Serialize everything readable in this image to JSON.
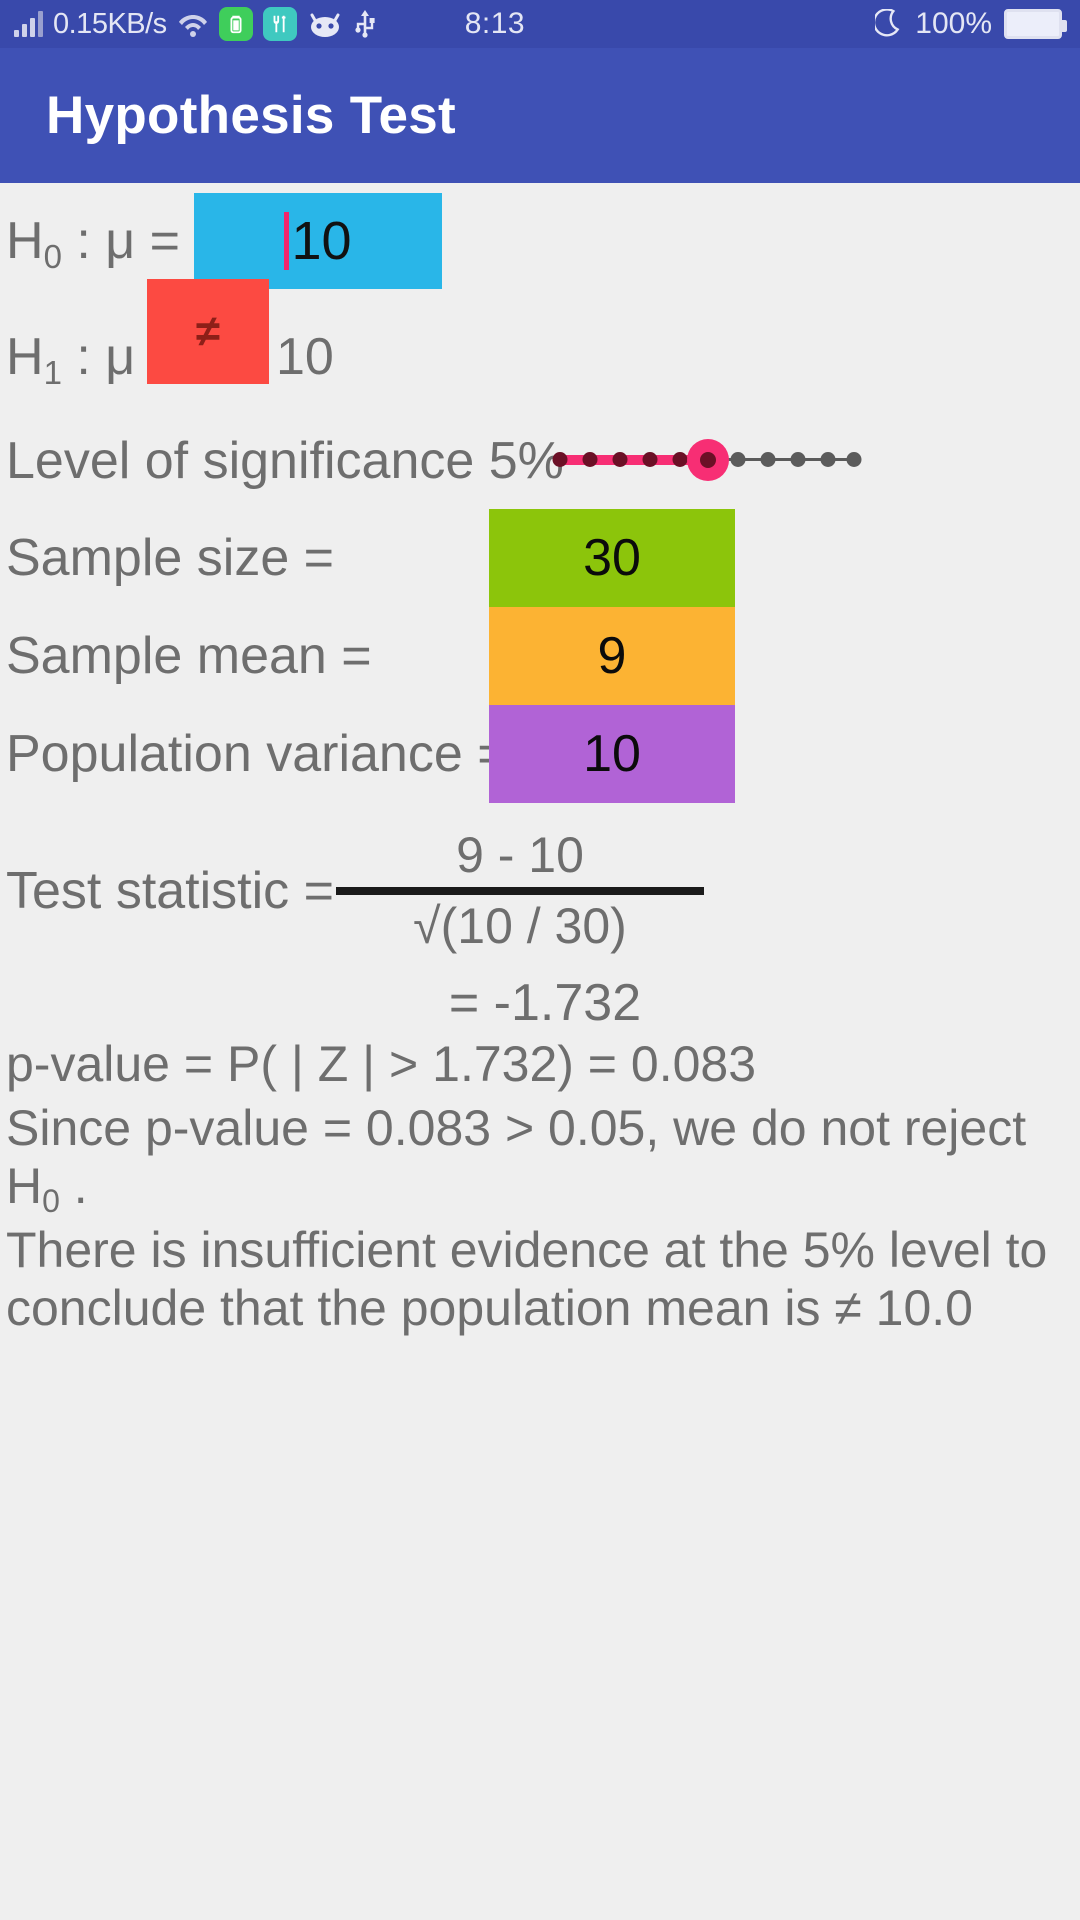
{
  "status_bar": {
    "network_speed": "0.15KB/s",
    "time": "8:13",
    "battery_percent": "100%",
    "icons": [
      "signal-bars-icon",
      "wifi-icon",
      "battery-saver-icon",
      "developer-tools-icon",
      "cyanogenmod-mascot-icon",
      "usb-icon",
      "do-not-disturb-moon-icon",
      "battery-full-icon"
    ]
  },
  "app_bar": {
    "title": "Hypothesis Test"
  },
  "form": {
    "null_hypothesis": {
      "label_prefix": "H",
      "label_sub": "0",
      "label_suffix": " : μ =",
      "value": "10",
      "field_color": "#29b6e8"
    },
    "alt_hypothesis": {
      "label_prefix": "H",
      "label_sub": "1",
      "label_suffix": " : μ",
      "operator": "≠",
      "value": "10",
      "spinner_color": "#fc4a42"
    },
    "significance": {
      "label": "Level of significance 5%",
      "value_percent": 5,
      "slider": {
        "min": 0,
        "max": 10,
        "value": 5,
        "steps": 11,
        "active_color": "#f72e74",
        "inactive_color": "#5b5b5b"
      }
    },
    "sample_size": {
      "label": "Sample size =",
      "value": "30",
      "field_color": "#8cc50b"
    },
    "sample_mean": {
      "label": "Sample mean =",
      "value": "9",
      "field_color": "#fcb333"
    },
    "population_variance": {
      "label": "Population variance =",
      "value": "10",
      "field_color": "#b163d6"
    }
  },
  "results": {
    "test_statistic_label": "Test statistic =",
    "numerator": "9 - 10",
    "denominator": "√(10 / 30)",
    "test_statistic_value": "= -1.732",
    "p_value_line": "p-value = P( | Z | > 1.732) = 0.083",
    "decision_line_1": "Since p-value = 0.083 > 0.05, we do not reject H",
    "decision_sub": "0",
    "decision_line_2": " .",
    "conclusion": "There is insufficient evidence at the 5% level to conclude that the population mean is ≠ 10.0"
  }
}
